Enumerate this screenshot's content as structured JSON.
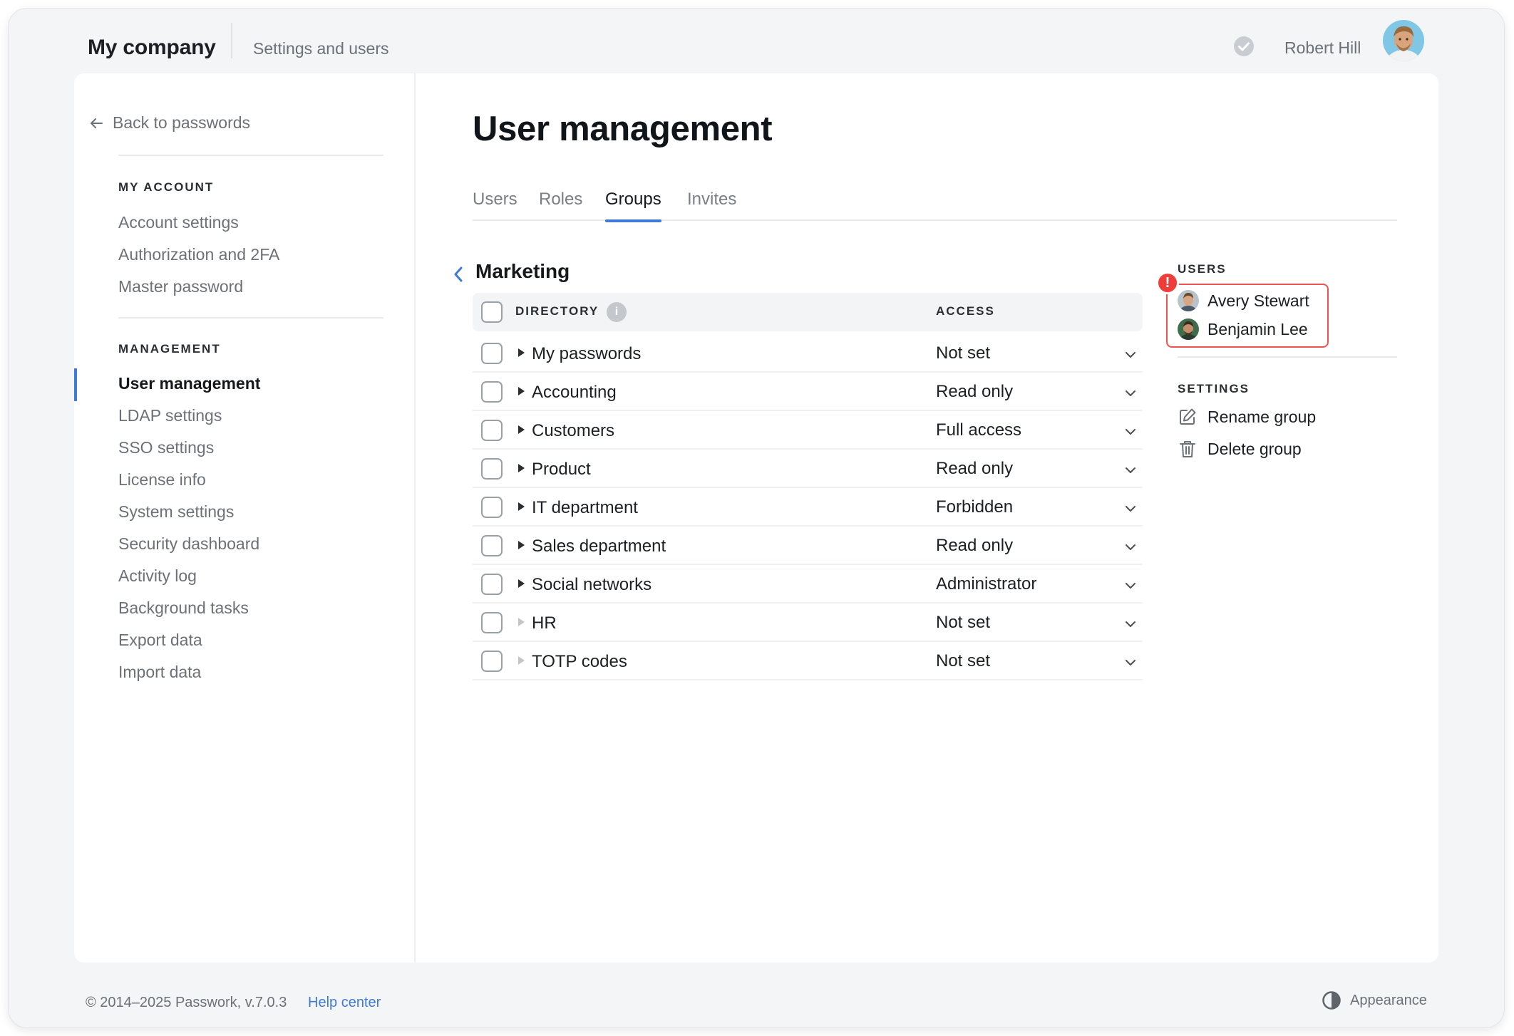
{
  "header": {
    "company": "My company",
    "breadcrumb": "Settings and users",
    "user_name": "Robert Hill"
  },
  "sidebar": {
    "back_label": "Back to passwords",
    "my_account_heading": "MY ACCOUNT",
    "my_account_items": [
      "Account settings",
      "Authorization and 2FA",
      "Master password"
    ],
    "management_heading": "MANAGEMENT",
    "management_items": [
      "User management",
      "LDAP settings",
      "SSO settings",
      "License info",
      "System settings",
      "Security dashboard",
      "Activity log",
      "Background tasks",
      "Export data",
      "Import data"
    ],
    "active_item": "User management"
  },
  "main": {
    "title": "User management",
    "tabs": [
      "Users",
      "Roles",
      "Groups",
      "Invites"
    ],
    "active_tab": "Groups",
    "group_name": "Marketing",
    "table": {
      "col_directory": "DIRECTORY",
      "col_access": "ACCESS",
      "rows": [
        {
          "directory": "My passwords",
          "access": "Not set",
          "expandable": true
        },
        {
          "directory": "Accounting",
          "access": "Read only",
          "expandable": true
        },
        {
          "directory": "Customers",
          "access": "Full access",
          "expandable": true
        },
        {
          "directory": "Product",
          "access": "Read only",
          "expandable": true
        },
        {
          "directory": "IT department",
          "access": "Forbidden",
          "expandable": true
        },
        {
          "directory": "Sales department",
          "access": "Read only",
          "expandable": true
        },
        {
          "directory": "Social networks",
          "access": "Administrator",
          "expandable": true
        },
        {
          "directory": "HR",
          "access": "Not set",
          "expandable": false
        },
        {
          "directory": "TOTP codes",
          "access": "Not set",
          "expandable": false
        }
      ]
    }
  },
  "right_panel": {
    "users_heading": "USERS",
    "warning_mark": "!",
    "users": [
      "Avery Stewart",
      "Benjamin Lee"
    ],
    "settings_heading": "SETTINGS",
    "rename_label": "Rename group",
    "delete_label": "Delete group"
  },
  "footer": {
    "copyright": "© 2014–2025 Passwork, v.7.0.3",
    "help": "Help center",
    "appearance": "Appearance"
  },
  "colors": {
    "accent": "#3f7ad6",
    "warning": "#ef3e3a"
  }
}
